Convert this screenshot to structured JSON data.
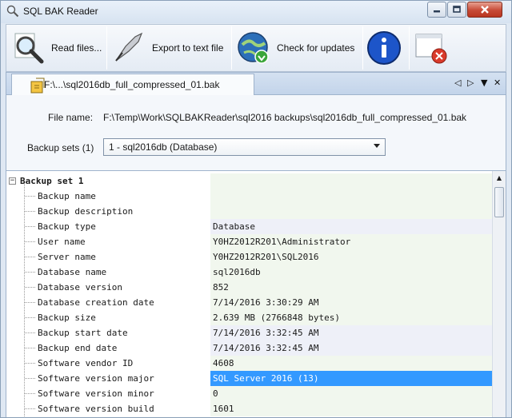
{
  "window": {
    "title": "SQL BAK Reader"
  },
  "toolbar": {
    "read_label": "Read files...",
    "export_label": "Export to text file",
    "updates_label": "Check for updates"
  },
  "tab": {
    "label": "F:\\...\\sql2016db_full_compressed_01.bak"
  },
  "form": {
    "file_name_label": "File name:",
    "file_name_value": "F:\\Temp\\Work\\SQLBAKReader\\sql2016 backups\\sql2016db_full_compressed_01.bak",
    "backup_sets_label": "Backup sets (1)",
    "backup_sets_value": "1 - sql2016db (Database)"
  },
  "grid": {
    "root_label": "Backup set 1",
    "rows": [
      {
        "name": "Backup name",
        "value": ""
      },
      {
        "name": "Backup description",
        "value": ""
      },
      {
        "name": "Backup type",
        "value": "Database"
      },
      {
        "name": "User name",
        "value": "Y0HZ2012R201\\Administrator"
      },
      {
        "name": "Server name",
        "value": "Y0HZ2012R201\\SQL2016"
      },
      {
        "name": "Database name",
        "value": "sql2016db"
      },
      {
        "name": "Database version",
        "value": "852"
      },
      {
        "name": "Database creation date",
        "value": "7/14/2016 3:30:29 AM"
      },
      {
        "name": "Backup size",
        "value": "2.639 MB (2766848 bytes)"
      },
      {
        "name": "Backup start date",
        "value": "7/14/2016 3:32:45 AM"
      },
      {
        "name": "Backup end date",
        "value": "7/14/2016 3:32:45 AM"
      },
      {
        "name": "Software vendor ID",
        "value": "4608"
      },
      {
        "name": "Software version major",
        "value": "SQL Server 2016 (13)"
      },
      {
        "name": "Software version minor",
        "value": "0"
      },
      {
        "name": "Software version build",
        "value": "1601"
      }
    ]
  },
  "colors": {
    "accent": "#3399ff",
    "close": "#c74a36"
  }
}
